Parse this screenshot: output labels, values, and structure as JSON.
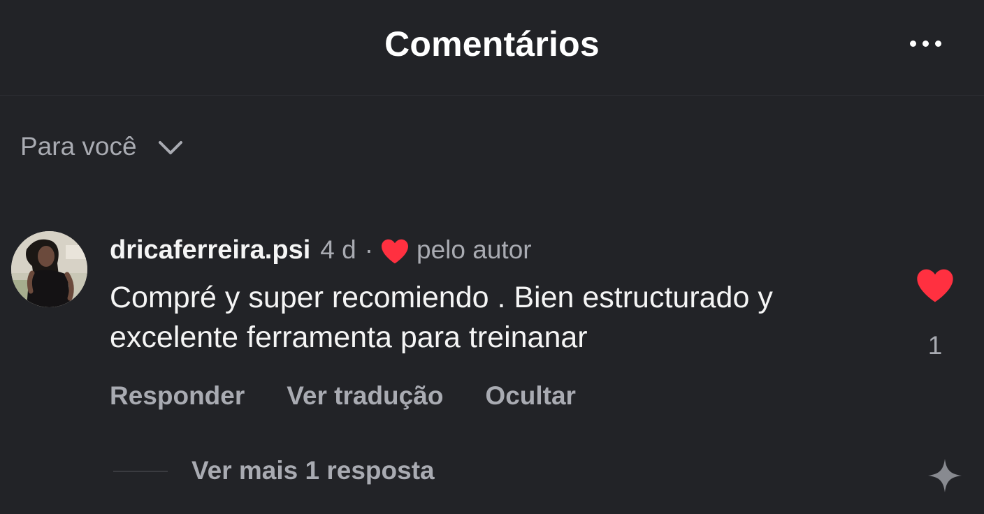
{
  "header": {
    "title": "Comentários",
    "more_icon": "more-horizontal-icon"
  },
  "sort": {
    "label": "Para você",
    "icon": "chevron-down-icon"
  },
  "comment": {
    "username": "dricaferreira.psi",
    "time": "4 d",
    "separator": "·",
    "author_like_icon": "heart-icon",
    "author_like_label": "pelo autor",
    "text": "Compré y super recomiendo . Bien estructurado y excelente ferramenta para treinanar",
    "like_icon": "heart-filled-icon",
    "like_count": "1",
    "liked": true,
    "actions": {
      "reply": "Responder",
      "translate": "Ver tradução",
      "hide": "Ocultar"
    },
    "view_replies": "Ver mais 1 resposta"
  },
  "colors": {
    "background": "#222327",
    "primary_text": "#f5f5f5",
    "secondary_text": "#a9abb2",
    "heart": "#ff3040"
  },
  "watermark_icon": "sparkle-icon"
}
